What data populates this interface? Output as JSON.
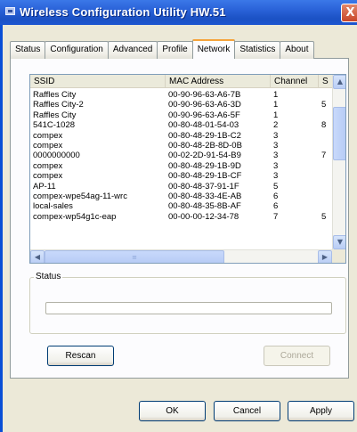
{
  "window": {
    "title": "Wireless Configuration Utility HW.51",
    "close_glyph": "X"
  },
  "tabs": [
    {
      "label": "Status",
      "active": false
    },
    {
      "label": "Configuration",
      "active": false
    },
    {
      "label": "Advanced",
      "active": false
    },
    {
      "label": "Profile",
      "active": false
    },
    {
      "label": "Network",
      "active": true
    },
    {
      "label": "Statistics",
      "active": false
    },
    {
      "label": "About",
      "active": false
    }
  ],
  "network_list": {
    "columns": [
      "SSID",
      "MAC Address",
      "Channel",
      "S"
    ],
    "rows": [
      {
        "ssid": "Raffles City",
        "mac": "00-90-96-63-A6-7B",
        "channel": "1",
        "s": ""
      },
      {
        "ssid": "Raffles City-2",
        "mac": "00-90-96-63-A6-3D",
        "channel": "1",
        "s": "5"
      },
      {
        "ssid": "Raffles City",
        "mac": "00-90-96-63-A6-5F",
        "channel": "1",
        "s": ""
      },
      {
        "ssid": "541C-1028",
        "mac": "00-80-48-01-54-03",
        "channel": "2",
        "s": "8"
      },
      {
        "ssid": "compex",
        "mac": "00-80-48-29-1B-C2",
        "channel": "3",
        "s": ""
      },
      {
        "ssid": "compex",
        "mac": "00-80-48-2B-8D-0B",
        "channel": "3",
        "s": ""
      },
      {
        "ssid": "0000000000",
        "mac": "00-02-2D-91-54-B9",
        "channel": "3",
        "s": "7"
      },
      {
        "ssid": "compex",
        "mac": "00-80-48-29-1B-9D",
        "channel": "3",
        "s": ""
      },
      {
        "ssid": "compex",
        "mac": "00-80-48-29-1B-CF",
        "channel": "3",
        "s": ""
      },
      {
        "ssid": "AP-11",
        "mac": "00-80-48-37-91-1F",
        "channel": "5",
        "s": ""
      },
      {
        "ssid": "compex-wpe54ag-11-wrc",
        "mac": "00-80-48-33-4E-AB",
        "channel": "6",
        "s": ""
      },
      {
        "ssid": "local-sales",
        "mac": "00-80-48-35-8B-AF",
        "channel": "6",
        "s": ""
      },
      {
        "ssid": "compex-wp54g1c-eap",
        "mac": "00-00-00-12-34-78",
        "channel": "7",
        "s": "5"
      }
    ]
  },
  "status_group": {
    "label": "Status",
    "progress": 0
  },
  "buttons": {
    "rescan": "Rescan",
    "connect": "Connect",
    "ok": "OK",
    "cancel": "Cancel",
    "apply": "Apply"
  },
  "icons": {
    "scroll_up": "up-arrow-icon",
    "scroll_down": "down-arrow-icon",
    "scroll_left": "left-arrow-icon",
    "scroll_right": "right-arrow-icon"
  },
  "colors": {
    "titlebar": "#1b51c4",
    "active_tab_accent": "#f5a33b",
    "dialog_bg": "#ece9d8"
  }
}
